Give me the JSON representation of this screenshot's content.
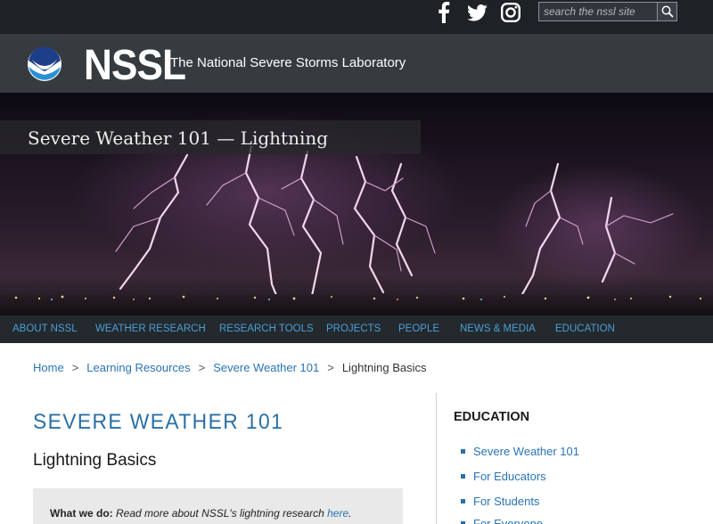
{
  "topbar": {
    "social_icons": [
      "facebook-icon",
      "twitter-icon",
      "instagram-icon"
    ],
    "search": {
      "placeholder": "search the nssl site",
      "button_icon": "search-icon"
    }
  },
  "header": {
    "logo_icon": "noaa-logo-icon",
    "brand": "NSSL",
    "subtitle": "The National Severe Storms Laboratory"
  },
  "hero": {
    "title": "Severe Weather 101  — Lightning"
  },
  "nav": {
    "items": [
      {
        "label": "ABOUT NSSL"
      },
      {
        "label": "WEATHER RESEARCH"
      },
      {
        "label": "RESEARCH TOOLS"
      },
      {
        "label": "PROJECTS"
      },
      {
        "label": "PEOPLE"
      },
      {
        "label": "NEWS & MEDIA"
      },
      {
        "label": "EDUCATION"
      }
    ]
  },
  "breadcrumb": {
    "items": [
      "Home",
      "Learning Resources",
      "Severe Weather 101"
    ],
    "separator": ">",
    "current": "Lightning Basics"
  },
  "main": {
    "section_title": "SEVERE WEATHER 101",
    "page_title": "Lightning Basics",
    "note": {
      "label": "What we do:",
      "text": " Read more about NSSL's lightning research ",
      "link": "here",
      "end": "."
    }
  },
  "sidebar": {
    "heading": "EDUCATION",
    "items": [
      {
        "label": "Severe Weather 101"
      },
      {
        "label": "For Educators"
      },
      {
        "label": "For Students"
      },
      {
        "label": "For Everyone"
      }
    ]
  },
  "colors": {
    "topbar_bg": "#1e2226",
    "header_bg": "#363b40",
    "nav_bg": "#24292d",
    "nav_link": "#4a9fd8",
    "link": "#2a74b5",
    "section_title": "#2a6fa5"
  }
}
